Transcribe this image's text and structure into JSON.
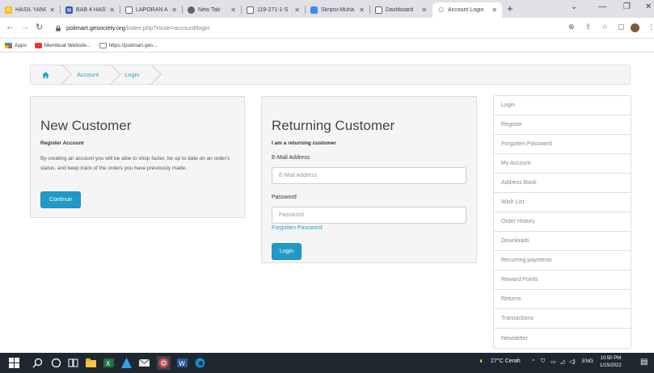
{
  "browser": {
    "tabs": [
      {
        "title": "HASIL YANG",
        "fav_color": "#fbbc04",
        "fav_glyph": "G"
      },
      {
        "title": "BAB 4 HASIL",
        "fav_color": "#3f51b5",
        "fav_glyph": "▤"
      },
      {
        "title": "LAPORAN AK",
        "fav_color": "#5f6368",
        "fav_glyph": "◎"
      },
      {
        "title": "New Tab",
        "fav_color": "#5f6368",
        "fav_glyph": "◉"
      },
      {
        "title": "119-271-1-S",
        "fav_color": "#5f6368",
        "fav_glyph": "◎"
      },
      {
        "title": "Skripsi-Muha",
        "fav_color": "#4285f4",
        "fav_glyph": "▯"
      },
      {
        "title": "Dashboard",
        "fav_color": "#5f6368",
        "fav_glyph": "◎"
      },
      {
        "title": "Account Login",
        "fav_color": "#ffffff",
        "fav_glyph": "⎔",
        "active": true
      }
    ],
    "new_tab_glyph": "+",
    "url_host": "polimart.gesociety.org",
    "url_path": "/index.php?route=account/login",
    "bookmarks": [
      {
        "label": "Apps",
        "color": "#4285f4"
      },
      {
        "label": "Membuat Website...",
        "color": "#e53935"
      },
      {
        "label": "https://polimart.ges...",
        "color": "#ffffff"
      }
    ]
  },
  "breadcrumb": {
    "items": [
      {
        "label": ""
      },
      {
        "label": "Account"
      },
      {
        "label": "Login"
      }
    ]
  },
  "new_customer": {
    "title": "New Customer",
    "subtitle": "Register Account",
    "text": "By creating an account you will be able to shop faster, be up to date on an order's status, and keep track of the orders you have previously made.",
    "button": "Continue"
  },
  "returning_customer": {
    "title": "Returning Customer",
    "subtitle": "I am a returning customer",
    "email_label": "E-Mail Address",
    "email_placeholder": "E-Mail Address",
    "password_label": "Password",
    "password_placeholder": "Password",
    "forgotten_link": "Forgotten Password",
    "button": "Login"
  },
  "sidebar": {
    "items": [
      {
        "label": "Login"
      },
      {
        "label": "Register"
      },
      {
        "label": "Forgotten Password"
      },
      {
        "label": "My Account"
      },
      {
        "label": "Address Book"
      },
      {
        "label": "Wish List"
      },
      {
        "label": "Order History"
      },
      {
        "label": "Downloads"
      },
      {
        "label": "Recurring payments"
      },
      {
        "label": "Reward Points"
      },
      {
        "label": "Returns"
      },
      {
        "label": "Transactions"
      },
      {
        "label": "Newsletter"
      }
    ]
  },
  "taskbar": {
    "weather": "27°C Cerah",
    "lang": "ENG",
    "time": "10:50 PM",
    "date": "1/15/2022"
  },
  "colors": {
    "accent": "#229ac8",
    "link": "#23a1d1",
    "panel_bg": "#f5f5f5",
    "taskbar_bg": "#1f2731"
  }
}
